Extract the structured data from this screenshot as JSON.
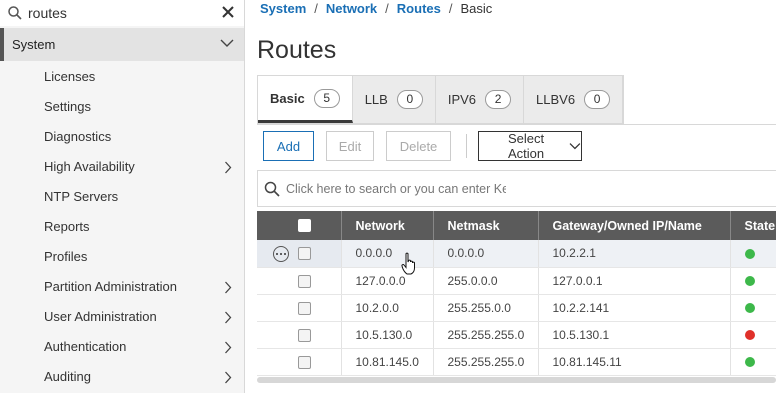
{
  "sidebar": {
    "search_value": "routes",
    "section_label": "System",
    "items": [
      {
        "label": "Licenses",
        "has_children": false
      },
      {
        "label": "Settings",
        "has_children": false
      },
      {
        "label": "Diagnostics",
        "has_children": false
      },
      {
        "label": "High Availability",
        "has_children": true
      },
      {
        "label": "NTP Servers",
        "has_children": false
      },
      {
        "label": "Reports",
        "has_children": false
      },
      {
        "label": "Profiles",
        "has_children": false
      },
      {
        "label": "Partition Administration",
        "has_children": true
      },
      {
        "label": "User Administration",
        "has_children": true
      },
      {
        "label": "Authentication",
        "has_children": true
      },
      {
        "label": "Auditing",
        "has_children": true
      }
    ]
  },
  "breadcrumb": {
    "items": [
      "System",
      "Network",
      "Routes"
    ],
    "current": "Basic",
    "separator": "/"
  },
  "page_title": "Routes",
  "tabs": [
    {
      "label": "Basic",
      "count": "5",
      "active": true
    },
    {
      "label": "LLB",
      "count": "0",
      "active": false
    },
    {
      "label": "IPV6",
      "count": "2",
      "active": false
    },
    {
      "label": "LLBV6",
      "count": "0",
      "active": false
    }
  ],
  "toolbar": {
    "add_label": "Add",
    "edit_label": "Edit",
    "delete_label": "Delete",
    "select_action_label": "Select Action"
  },
  "search": {
    "placeholder": "Click here to search or you can enter Ke"
  },
  "table": {
    "columns": [
      "Network",
      "Netmask",
      "Gateway/Owned IP/Name",
      "State"
    ],
    "rows": [
      {
        "network": "0.0.0.0",
        "netmask": "0.0.0.0",
        "gateway": "10.2.2.1",
        "state": "up"
      },
      {
        "network": "127.0.0.0",
        "netmask": "255.0.0.0",
        "gateway": "127.0.0.1",
        "state": "up"
      },
      {
        "network": "10.2.0.0",
        "netmask": "255.255.0.0",
        "gateway": "10.2.2.141",
        "state": "up"
      },
      {
        "network": "10.5.130.0",
        "netmask": "255.255.255.0",
        "gateway": "10.5.130.1",
        "state": "down"
      },
      {
        "network": "10.81.145.0",
        "netmask": "255.255.255.0",
        "gateway": "10.81.145.11",
        "state": "up"
      }
    ]
  },
  "colors": {
    "link": "#1a6fb5",
    "state_up": "#3db84a",
    "state_down": "#e0302a",
    "header_bg": "#5b5b5b"
  }
}
